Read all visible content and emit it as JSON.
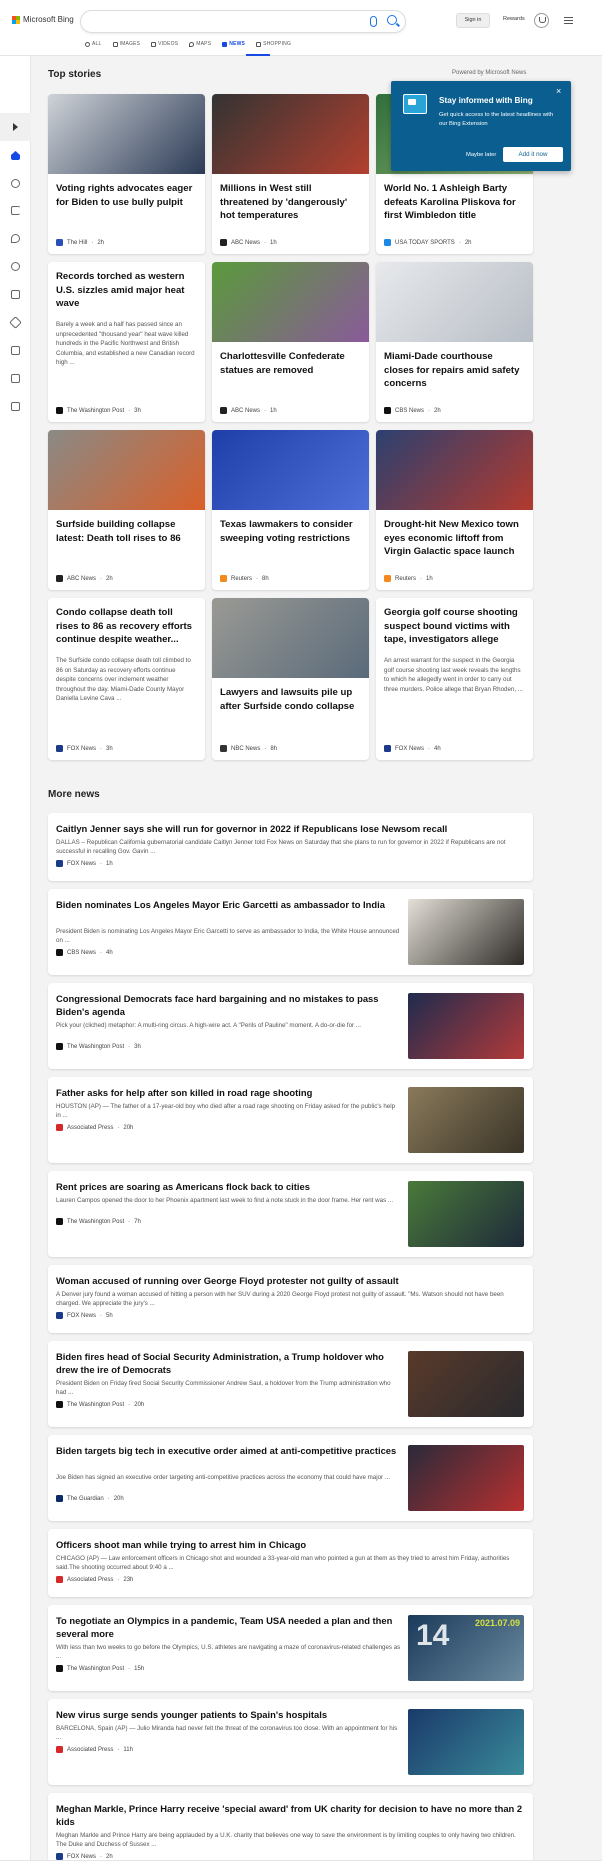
{
  "header": {
    "brand": "Microsoft Bing",
    "signin": "Sign in",
    "rewards": "Rewards",
    "tabs": [
      {
        "label": "ALL",
        "icon": "search-icon"
      },
      {
        "label": "IMAGES",
        "icon": "image-icon"
      },
      {
        "label": "VIDEOS",
        "icon": "video-icon"
      },
      {
        "label": "MAPS",
        "icon": "map-pin-icon"
      },
      {
        "label": "NEWS",
        "icon": "news-icon"
      },
      {
        "label": "SHOPPING",
        "icon": "shopping-bag-icon"
      }
    ],
    "active_tab": "NEWS",
    "accent": "#174ae4"
  },
  "top_stories": {
    "heading": "Top stories",
    "powered": "Powered by Microsoft News",
    "cards": [
      {
        "title": "Voting rights advocates eager for Biden to use bully pulpit",
        "abstract": "",
        "source": "The Hill",
        "age": "2h",
        "source_color": "#2a4fb7",
        "img_colors": [
          "#cfd3d8",
          "#2b3a55"
        ]
      },
      {
        "title": "Millions in West still threatened by 'dangerously' hot temperatures",
        "abstract": "",
        "source": "ABC News",
        "age": "1h",
        "source_color": "#222",
        "img_colors": [
          "#333",
          "#b2402f"
        ]
      },
      {
        "title": "World No. 1 Ashleigh Barty defeats Karolina Pliskova for first Wimbledon title",
        "abstract": "",
        "source": "USA TODAY SPORTS",
        "age": "2h",
        "source_color": "#1e88e5",
        "img_colors": [
          "#2f6e3b",
          "#9bbf7a"
        ]
      },
      {
        "title": "Records torched as western U.S. sizzles amid major heat wave",
        "abstract": "Barely a week and a half has passed since an unprecedented \"thousand year\" heat wave killed hundreds in the Pacific Northwest and British Columbia, and established a new Canadian record high ...",
        "source": "The Washington Post",
        "age": "3h",
        "source_color": "#111",
        "img_colors": []
      },
      {
        "title": "Charlottesville Confederate statues are removed",
        "abstract": "",
        "source": "ABC News",
        "age": "1h",
        "source_color": "#222",
        "img_colors": [
          "#5a9a3a",
          "#8a5a9a"
        ]
      },
      {
        "title": "Miami-Dade courthouse closes for repairs amid safety concerns",
        "abstract": "",
        "source": "CBS News",
        "age": "2h",
        "source_color": "#111",
        "img_colors": [
          "#e7e9ec",
          "#b8bec6"
        ]
      },
      {
        "title": "Surfside building collapse latest: Death toll rises to 86",
        "abstract": "",
        "source": "ABC News",
        "age": "2h",
        "source_color": "#222",
        "img_colors": [
          "#8a8a86",
          "#d9602a"
        ]
      },
      {
        "title": "Texas lawmakers to consider sweeping voting restrictions",
        "abstract": "",
        "source": "Reuters",
        "age": "8h",
        "source_color": "#f28a1e",
        "img_colors": [
          "#1e3fa8",
          "#4e6fd8"
        ]
      },
      {
        "title": "Drought-hit New Mexico town eyes economic liftoff from Virgin Galactic space launch",
        "abstract": "",
        "source": "Reuters",
        "age": "1h",
        "source_color": "#f28a1e",
        "img_colors": [
          "#2b4070",
          "#b23a2e"
        ]
      },
      {
        "title": "Condo collapse death toll rises to 86 as recovery efforts continue despite weather...",
        "abstract": "The Surfside condo collapse death toll climbed to 86 on Saturday as recovery efforts continue despite concerns over inclement weather throughout the day. Miami-Dade County Mayor Daniella Levine Cava ...",
        "source": "FOX News",
        "age": "3h",
        "source_color": "#1a3a8a",
        "img_colors": []
      },
      {
        "title": "Lawyers and lawsuits pile up after Surfside condo collapse",
        "abstract": "",
        "source": "NBC News",
        "age": "8h",
        "source_color": "#333",
        "img_colors": [
          "#9a9a94",
          "#5a6a7a"
        ]
      },
      {
        "title": "Georgia golf course shooting suspect bound victims with tape, investigators allege",
        "abstract": "An arrest warrant for the suspect in the Georgia golf course shooting last week reveals the lengths to which he allegedly went in order to carry out three murders. Police allege that Bryan Rhoden, ...",
        "source": "FOX News",
        "age": "4h",
        "source_color": "#1a3a8a",
        "img_colors": []
      }
    ]
  },
  "popup": {
    "title": "Stay informed with Bing",
    "body": "Get quick access to the latest headlines with our Bing Extension",
    "later": "Maybe later",
    "add": "Add it now"
  },
  "more_news": {
    "heading": "More news",
    "items": [
      {
        "title": "Caitlyn Jenner says she will run for governor in 2022 if Republicans lose Newsom recall",
        "abstract": "DALLAS – Republican California gubernatorial candidate Caitlyn Jenner told Fox News on Saturday that she plans to run for governor in 2022 if Republicans are not successful in recalling Gov. Gavin ...",
        "source": "FOX News",
        "age": "1h",
        "source_color": "#1a3a8a",
        "has_thumb": false,
        "thumb_colors": []
      },
      {
        "title": "Biden nominates Los Angeles Mayor Eric Garcetti as ambassador to India",
        "abstract": "President Biden is nominating Los Angeles Mayor Eric Garcetti to serve as ambassador to India, the White House announced on ...",
        "source": "CBS News",
        "age": "4h",
        "source_color": "#111",
        "has_thumb": true,
        "thumb_colors": [
          "#e4e0d8",
          "#2e2a26"
        ]
      },
      {
        "title": "Congressional Democrats face hard bargaining and no mistakes to pass Biden's agenda",
        "abstract": "Pick your (cliched) metaphor: A multi-ring circus. A high-wire act. A \"Perils of Pauline\" moment. A do-or-die for ...",
        "source": "The Washington Post",
        "age": "3h",
        "source_color": "#111",
        "has_thumb": true,
        "thumb_colors": [
          "#1f2b4e",
          "#b23a3a"
        ]
      },
      {
        "title": "Father asks for help after son killed in road rage shooting",
        "abstract": "HOUSTON (AP) — The father of a 17-year-old boy who died after a road rage shooting on Friday asked for the public's help in ...",
        "source": "Associated Press",
        "age": "20h",
        "source_color": "#d62828",
        "has_thumb": true,
        "thumb_colors": [
          "#8a7a5a",
          "#3a3428"
        ]
      },
      {
        "title": "Rent prices are soaring as Americans flock back to cities",
        "abstract": "Lauren Campos opened the door to her Phoenix apartment last week to find a note stuck in the door frame. Her rent was ...",
        "source": "The Washington Post",
        "age": "7h",
        "source_color": "#111",
        "has_thumb": true,
        "thumb_colors": [
          "#4a7a3a",
          "#1e2a3a"
        ]
      },
      {
        "title": "Woman accused of running over George Floyd protester not guilty of assault",
        "abstract": "A Denver jury found a woman accused of hitting a person with her SUV during a 2020 George Floyd protest not guilty of assault. \"Ms. Watson should not have been charged. We appreciate the jury's ...",
        "source": "FOX News",
        "age": "5h",
        "source_color": "#1a3a8a",
        "has_thumb": false,
        "thumb_colors": []
      },
      {
        "title": "Biden fires head of Social Security Administration, a Trump holdover who drew the ire of Democrats",
        "abstract": "President Biden on Friday fired Social Security Commissioner Andrew Saul, a holdover from the Trump administration who had ...",
        "source": "The Washington Post",
        "age": "20h",
        "source_color": "#111",
        "has_thumb": true,
        "thumb_colors": [
          "#5a3a2a",
          "#2a2a2e"
        ]
      },
      {
        "title": "Biden targets big tech in executive order aimed at anti-competitive practices",
        "abstract": "Joe Biden has signed an executive order targeting anti-competitive practices across the economy that could have major ...",
        "source": "The Guardian",
        "age": "20h",
        "source_color": "#0a2a6a",
        "has_thumb": true,
        "thumb_colors": [
          "#2a2a3a",
          "#b83030"
        ]
      },
      {
        "title": "Officers shoot man while trying to arrest him in Chicago",
        "abstract": "CHICAGO (AP) — Law enforcement officers in Chicago shot and wounded a 33-year-old man who pointed a gun at them as they tried to arrest him Friday, authorities said.The shooting occurred about 9:40 a ...",
        "source": "Associated Press",
        "age": "23h",
        "source_color": "#d62828",
        "has_thumb": false,
        "thumb_colors": []
      },
      {
        "title": "To negotiate an Olympics in a pandemic, Team USA needed a plan and then several more",
        "abstract": "With less than two weeks to go before the Olympics, U.S. athletes are navigating a maze of coronavirus-related challenges as ...",
        "source": "The Washington Post",
        "age": "15h",
        "source_color": "#111",
        "has_thumb": true,
        "thumb_colors": [
          "#1a3a5a",
          "#6a8aa0"
        ],
        "thumb_text": "14",
        "thumb_date": "2021.07.09"
      },
      {
        "title": "New virus surge sends younger patients to Spain's hospitals",
        "abstract": "BARCELONA, Spain (AP) — Julio Miranda had never felt the threat of the coronavirus too close. With an appointment for his ...",
        "source": "Associated Press",
        "age": "11h",
        "source_color": "#d62828",
        "has_thumb": true,
        "thumb_colors": [
          "#1a3a6a",
          "#3a8a9a"
        ]
      },
      {
        "title": "Meghan Markle, Prince Harry receive 'special award' from UK charity for decision to have no more than 2 kids",
        "abstract": "Meghan Markle and Prince Harry are being applauded by a U.K. charity that believes one way to save the environment is by limiting couples to only having two children. The Duke and Duchess of Sussex ...",
        "source": "FOX News",
        "age": "2h",
        "source_color": "#1a3a8a",
        "has_thumb": false,
        "thumb_colors": []
      }
    ]
  }
}
